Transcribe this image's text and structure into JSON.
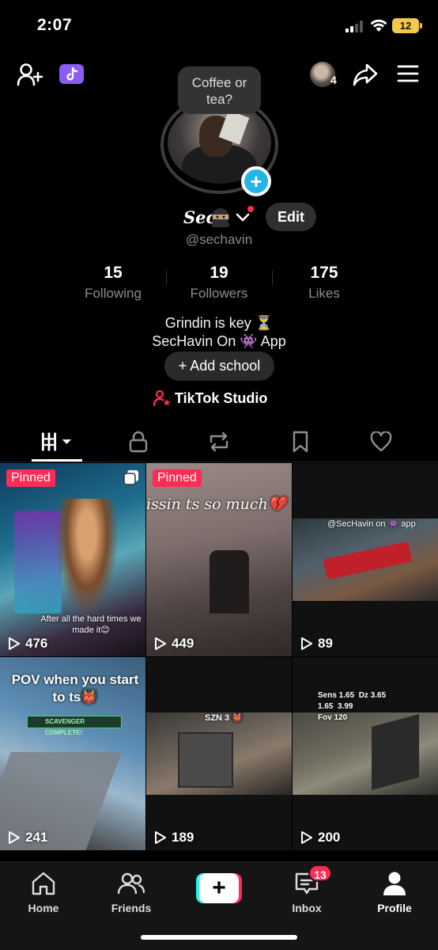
{
  "status_bar": {
    "time": "2:07",
    "battery": "12"
  },
  "header": {
    "tooltip": "Coffee or tea?",
    "avatar_count": "4"
  },
  "profile": {
    "name": "Sec",
    "username": "@sechavin",
    "edit_label": "Edit",
    "stats": [
      {
        "value": "15",
        "label": "Following"
      },
      {
        "value": "19",
        "label": "Followers"
      },
      {
        "value": "175",
        "label": "Likes"
      }
    ],
    "bio_line1": "Grindin is key ⏳",
    "bio_line2": "SecHavin On 👾 App",
    "add_school_label": "+ Add school",
    "studio_label": "TikTok Studio"
  },
  "tabs": [
    "videos-icon",
    "lock-icon",
    "repost-icon",
    "bookmark-icon",
    "heart-icon"
  ],
  "videos": [
    {
      "views": "476",
      "pinned": "Pinned",
      "caption": "After all the hard times we made it😊"
    },
    {
      "views": "449",
      "pinned": "Pinned",
      "caption": "issin ts so much💔"
    },
    {
      "views": "89",
      "caption": "@SecHavin on 👾 app"
    },
    {
      "views": "241",
      "caption": "POV when you start to ts👹",
      "overlay": "SCAVENGER COMPLETE!"
    },
    {
      "views": "189",
      "caption": "SZN 3 👹"
    },
    {
      "views": "200",
      "caption": "Sens 1.65  Dz 3.65\n1.65  3.99\nFov 120"
    }
  ],
  "bottom_nav": {
    "home": "Home",
    "friends": "Friends",
    "create_symbol": "+",
    "inbox": "Inbox",
    "inbox_badge": "13",
    "profile": "Profile"
  },
  "colors": {
    "accent": "#fe2c55",
    "cyan": "#25f4ee",
    "badge_blue": "#22b5e6",
    "purple": "#8b5cf6"
  }
}
